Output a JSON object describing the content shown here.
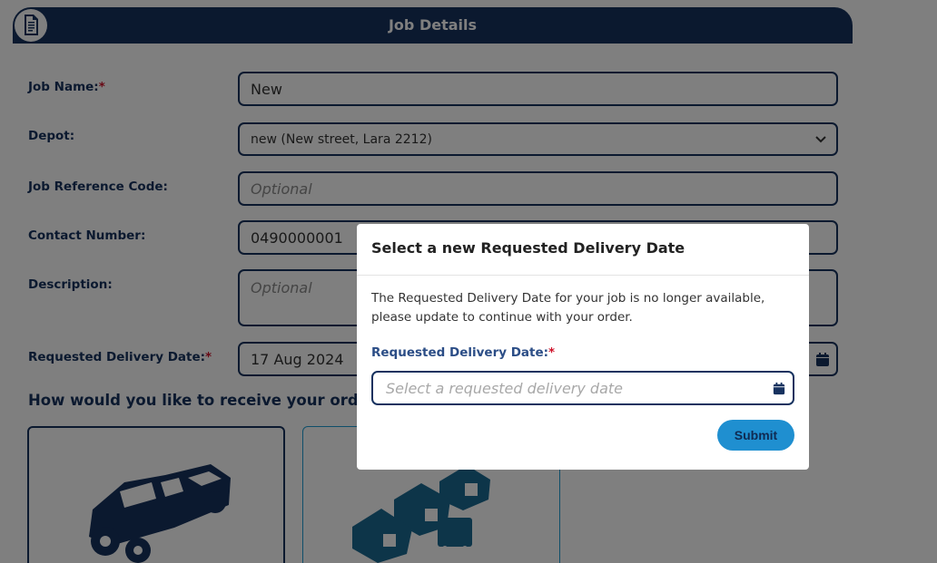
{
  "header": {
    "title": "Job Details",
    "icon": "document-icon"
  },
  "form": {
    "job_name": {
      "label": "Job Name:",
      "required": "*",
      "value": "New"
    },
    "depot": {
      "label": "Depot:",
      "value": "new (New street, Lara 2212)"
    },
    "job_reference": {
      "label": "Job Reference Code:",
      "placeholder": "Optional"
    },
    "contact_number": {
      "label": "Contact Number:",
      "value": "0490000001"
    },
    "description": {
      "label": "Description:",
      "placeholder": "Optional"
    },
    "delivery_date": {
      "label": "Requested Delivery Date:",
      "required": "*",
      "value": "17 Aug 2024"
    }
  },
  "receive_question": "How would you like to receive your order?",
  "receive_options": [
    {
      "icon": "pickup-truck-icon"
    },
    {
      "icon": "houses-delivery-icon"
    }
  ],
  "modal": {
    "title": "Select a new Requested Delivery Date",
    "message": "The Requested Delivery Date for your job is no longer available, please update to continue with your order.",
    "field_label": "Requested Delivery Date:",
    "required": "*",
    "placeholder": "Select a requested delivery date",
    "submit_label": "Submit"
  },
  "colors": {
    "navy": "#17325f",
    "accent": "#1f8fd0",
    "required": "#d0132b"
  }
}
